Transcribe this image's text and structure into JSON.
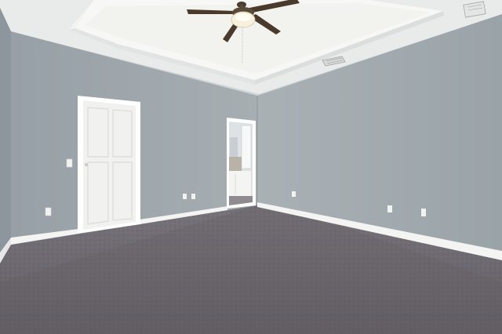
{
  "scene": {
    "description_type": "photo",
    "colors": {
      "wall": "#a3acb1",
      "wall_shadow": "#8f989e",
      "ceiling": "#eef0ef",
      "tray_ceiling": "#f5f5f3",
      "carpet": "#6e6a70",
      "carpet_dark": "#5c585e",
      "trim": "#ffffff",
      "door": "#f3f3f1",
      "fan_blade": "#4a3a2c",
      "fan_light": "#f7f1dc"
    },
    "objects": [
      "ceiling-fan-icon",
      "door-icon",
      "doorway-icon",
      "vent-icon",
      "outlet-icon",
      "light-switch-icon",
      "carpet-floor",
      "baseboard"
    ]
  }
}
